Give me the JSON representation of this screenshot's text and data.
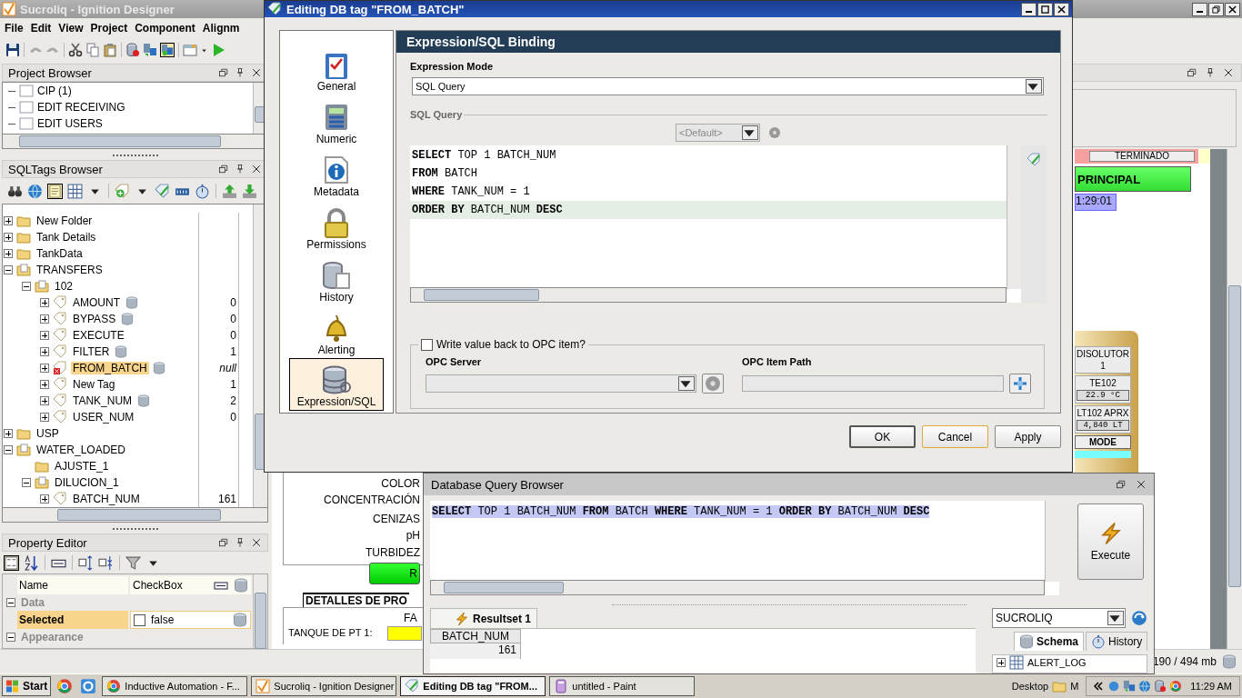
{
  "designer": {
    "title": "Sucroliq - Ignition Designer",
    "menu": [
      "File",
      "Edit",
      "View",
      "Project",
      "Component",
      "Alignm"
    ],
    "status": "190 / 494 mb"
  },
  "project_browser": {
    "title": "Project Browser",
    "items": [
      "CIP (1)",
      "EDIT RECEIVING",
      "EDIT USERS"
    ]
  },
  "sqltags_browser": {
    "title": "SQLTags Browser",
    "tree": [
      {
        "label": "New Folder",
        "kind": "folder",
        "expanded": false,
        "selected": false
      },
      {
        "label": "Tank Details",
        "kind": "folder",
        "expanded": false,
        "selected": false
      },
      {
        "label": "TankData",
        "kind": "folder",
        "expanded": false,
        "selected": false
      },
      {
        "label": "TRANSFERS",
        "kind": "folder",
        "expanded": true,
        "selected": false,
        "children": [
          {
            "label": "102",
            "kind": "folder",
            "expanded": true,
            "selected": false,
            "children": [
              {
                "label": "AMOUNT",
                "kind": "db_tag",
                "expanded": false,
                "selected": false,
                "value": "0"
              },
              {
                "label": "BYPASS",
                "kind": "db_tag",
                "expanded": false,
                "selected": false,
                "value": "0"
              },
              {
                "label": "EXECUTE",
                "kind": "tag",
                "expanded": false,
                "selected": false,
                "value": "0"
              },
              {
                "label": "FILTER",
                "kind": "db_tag",
                "expanded": false,
                "selected": false,
                "value": "1"
              },
              {
                "label": "FROM_BATCH",
                "kind": "db_tag",
                "expanded": false,
                "selected": true,
                "error": true,
                "value": "null"
              },
              {
                "label": "New Tag",
                "kind": "tag",
                "expanded": false,
                "selected": false,
                "value": "1"
              },
              {
                "label": "TANK_NUM",
                "kind": "db_tag",
                "expanded": false,
                "selected": false,
                "value": "2"
              },
              {
                "label": "USER_NUM",
                "kind": "tag",
                "expanded": false,
                "selected": false,
                "value": "0"
              }
            ]
          }
        ]
      },
      {
        "label": "USP",
        "kind": "folder",
        "expanded": false,
        "selected": false
      },
      {
        "label": "WATER_LOADED",
        "kind": "folder",
        "expanded": true,
        "selected": false,
        "children": [
          {
            "label": "AJUSTE_1",
            "kind": "folder",
            "selected": false
          },
          {
            "label": "DILUCION_1",
            "kind": "folder",
            "expanded": true,
            "selected": false,
            "children": [
              {
                "label": "BATCH_NUM",
                "kind": "tag",
                "expanded": false,
                "selected": false,
                "value": "161"
              }
            ]
          }
        ]
      }
    ]
  },
  "property_editor": {
    "title": "Property Editor",
    "header": {
      "name": "Name",
      "value": "CheckBox"
    },
    "categories": [
      {
        "label": "Data",
        "expanded": true,
        "rows": [
          {
            "name": "Selected",
            "value": "false",
            "checked": false,
            "selected": true
          }
        ]
      },
      {
        "label": "Appearance",
        "expanded": true
      }
    ]
  },
  "canvas": {
    "labels": [
      "COLOR",
      "CONCENTRACIÓN",
      "CENIZAS",
      "pH",
      "TURBIDEZ"
    ],
    "button": "R",
    "section": "DETALLES DE PRO",
    "fa": "FA",
    "tank_label": "TANQUE DE PT 1:",
    "status_button": "TERMINADO",
    "principal": "PRINCIPAL",
    "time": "1:29:01",
    "tank": {
      "name": "DISOLUTOR",
      "number": "1",
      "temp_label": "TE102",
      "temp": "22.9 °C",
      "level_label": "LT102 APRX",
      "level_value": "4,840 LT",
      "mode": "MODE"
    }
  },
  "dialog": {
    "title": "Editing DB tag \"FROM_BATCH\"",
    "nav": [
      {
        "label": "General",
        "selected": false
      },
      {
        "label": "Numeric",
        "selected": false
      },
      {
        "label": "Metadata",
        "selected": false
      },
      {
        "label": "Permissions",
        "selected": false
      },
      {
        "label": "History",
        "selected": false
      },
      {
        "label": "Alerting",
        "selected": false
      },
      {
        "label": "Expression/SQL",
        "selected": true
      }
    ],
    "heading": "Expression/SQL Binding",
    "mode_label": "Expression Mode",
    "mode": "SQL Query",
    "group": "SQL Query",
    "datasource": "<Default>",
    "code": [
      {
        "text": "**SELECT** TOP 1 BATCH_NUM",
        "current": false
      },
      {
        "text": "**FROM** BATCH",
        "current": false
      },
      {
        "text": "**WHERE** TANK_NUM = 1",
        "current": false
      },
      {
        "text": "**ORDER BY** BATCH_NUM **DESC**",
        "current": true
      }
    ],
    "writeback": {
      "label": "Write value back to OPC item?",
      "checked": false
    },
    "opc_server_label": "OPC Server",
    "opc_path_label": "OPC Item Path",
    "buttons": [
      "OK",
      "Cancel",
      "Apply"
    ]
  },
  "query_browser": {
    "title": "Database Query Browser",
    "query": "**SELECT** TOP 1 BATCH_NUM **FROM** BATCH **WHERE** TANK_NUM = 1 **ORDER BY** BATCH_NUM **DESC**",
    "execute": "Execute",
    "result_tab": "Resultset 1",
    "columns": [
      "BATCH_NUM"
    ],
    "rows": [
      [
        "161"
      ]
    ],
    "datasource": "SUCROLIQ",
    "tabs": [
      {
        "label": "Schema",
        "selected": true
      },
      {
        "label": "History",
        "selected": false
      }
    ],
    "schema_items": [
      "ALERT_LOG"
    ]
  },
  "taskbar": {
    "start": "Start",
    "tasks": [
      {
        "label": "Inductive Automation - F...",
        "selected": false
      },
      {
        "label": "Sucroliq - Ignition Designer",
        "selected": false
      },
      {
        "label": "Editing DB tag \"FROM...",
        "selected": true
      },
      {
        "label": "untitled - Paint",
        "selected": false
      }
    ],
    "desktop": "Desktop",
    "folder": "M",
    "clock": "11:29 AM"
  }
}
